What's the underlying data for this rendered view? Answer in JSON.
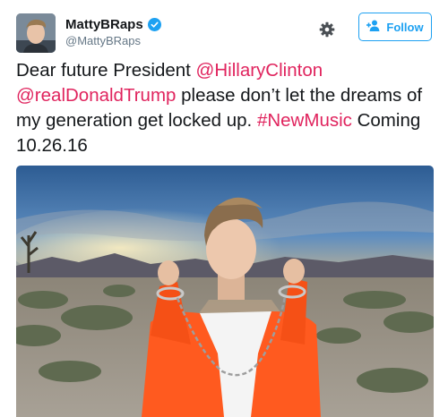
{
  "user": {
    "display_name": "MattyBRaps",
    "handle": "@MattyBRaps"
  },
  "actions": {
    "follow_label": "Follow"
  },
  "tweet": {
    "text_1": "Dear future President ",
    "mention_1": "@HillaryClinton",
    "mention_2": "@realDonaldTrump",
    "text_2": " please don’t let the dreams of my generation get locked up. ",
    "hashtag": "#NewMusic",
    "text_3": " Coming 10.26.16"
  },
  "icons": {
    "verified": "verified-badge-icon",
    "settings": "gear-icon",
    "follow": "add-user-icon"
  },
  "colors": {
    "link": "#e0245e",
    "accent": "#1da1f2",
    "jumpsuit": "#ff5a1f"
  }
}
